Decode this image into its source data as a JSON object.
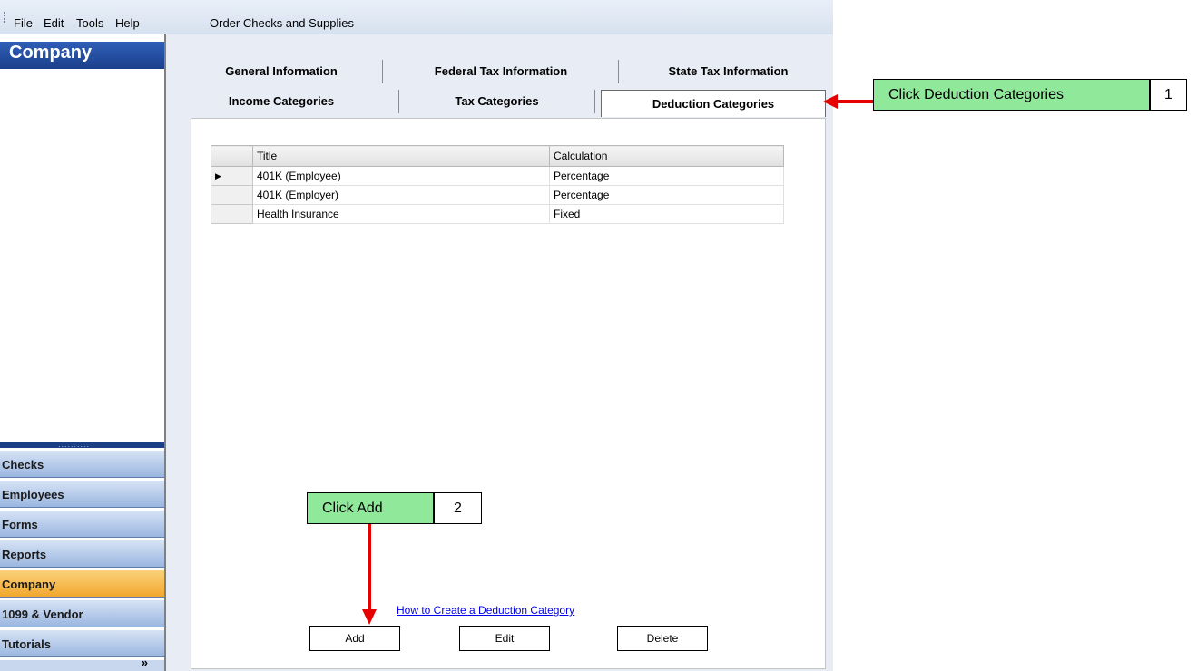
{
  "menubar": {
    "items": [
      {
        "label": "File"
      },
      {
        "label": "Edit"
      },
      {
        "label": "Tools"
      },
      {
        "label": "Help"
      },
      {
        "label": "Order Checks and Supplies"
      }
    ]
  },
  "nav": {
    "header": "Company",
    "buttons": [
      {
        "label": "Checks"
      },
      {
        "label": "Employees"
      },
      {
        "label": "Forms"
      },
      {
        "label": "Reports"
      },
      {
        "label": "Company",
        "active": true
      },
      {
        "label": "1099 & Vendor"
      },
      {
        "label": "Tutorials"
      }
    ],
    "footer_glyph": "»"
  },
  "tabs": {
    "row1": [
      {
        "label": "General Information"
      },
      {
        "label": "Federal Tax Information"
      },
      {
        "label": "State Tax Information"
      }
    ],
    "row2": [
      {
        "label": "Income Categories"
      },
      {
        "label": "Tax Categories"
      },
      {
        "label": "Deduction Categories",
        "active": true
      }
    ]
  },
  "grid": {
    "columns": [
      "Title",
      "Calculation"
    ],
    "row_pointer": "▶",
    "rows": [
      {
        "title": "401K (Employee)",
        "calculation": "Percentage",
        "current": true
      },
      {
        "title": "401K (Employer)",
        "calculation": "Percentage"
      },
      {
        "title": "Health Insurance",
        "calculation": "Fixed"
      }
    ]
  },
  "help_link": "How to Create a Deduction Category",
  "buttons": {
    "add": "Add",
    "edit": "Edit",
    "delete": "Delete"
  },
  "callouts": [
    {
      "text": "Click Deduction Categories",
      "number": "1"
    },
    {
      "text": "Click Add",
      "number": "2"
    }
  ],
  "colors": {
    "callout_fill": "#90e89a",
    "arrow": "#e60000",
    "nav_active": "#f2a72e",
    "nav_header": "#1c3f8c"
  }
}
